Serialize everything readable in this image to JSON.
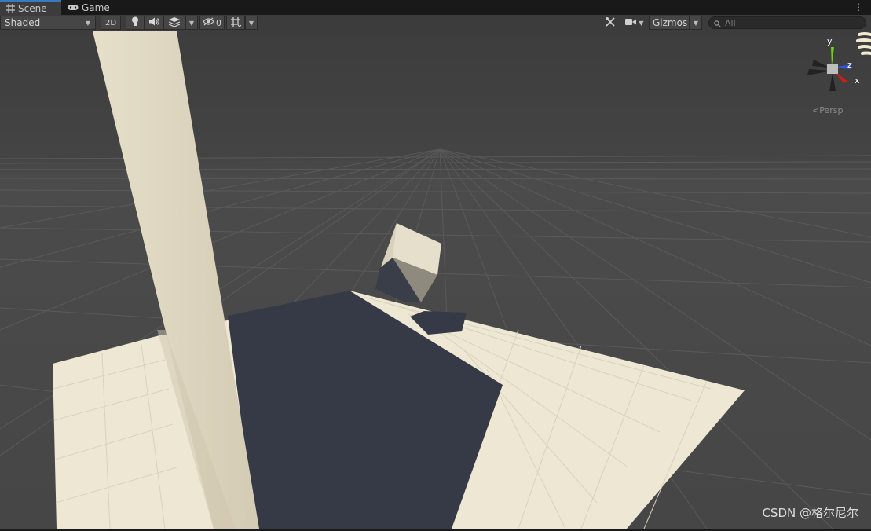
{
  "tabs": [
    {
      "label": "Scene",
      "icon": "grid-icon",
      "active": true
    },
    {
      "label": "Game",
      "icon": "gamepad-icon",
      "active": false
    }
  ],
  "toolbar": {
    "draw_mode": "Shaded",
    "mode_2d": "2D",
    "hidden_count": "0",
    "gizmos_label": "Gizmos",
    "search_placeholder": "All"
  },
  "gizmo": {
    "axis_y": "y",
    "axis_z": "z",
    "axis_x": "x",
    "projection_label": "Persp"
  },
  "colors": {
    "background": "#474747",
    "grid": "#5a5a5a",
    "surface": "#ede7d4",
    "shadow": "#363a46",
    "accent_tab": "#3a79bb",
    "axis_x": "#c8201a",
    "axis_y": "#6fd20f",
    "axis_z": "#3156d8"
  },
  "watermark": "CSDN @格尔尼尔"
}
